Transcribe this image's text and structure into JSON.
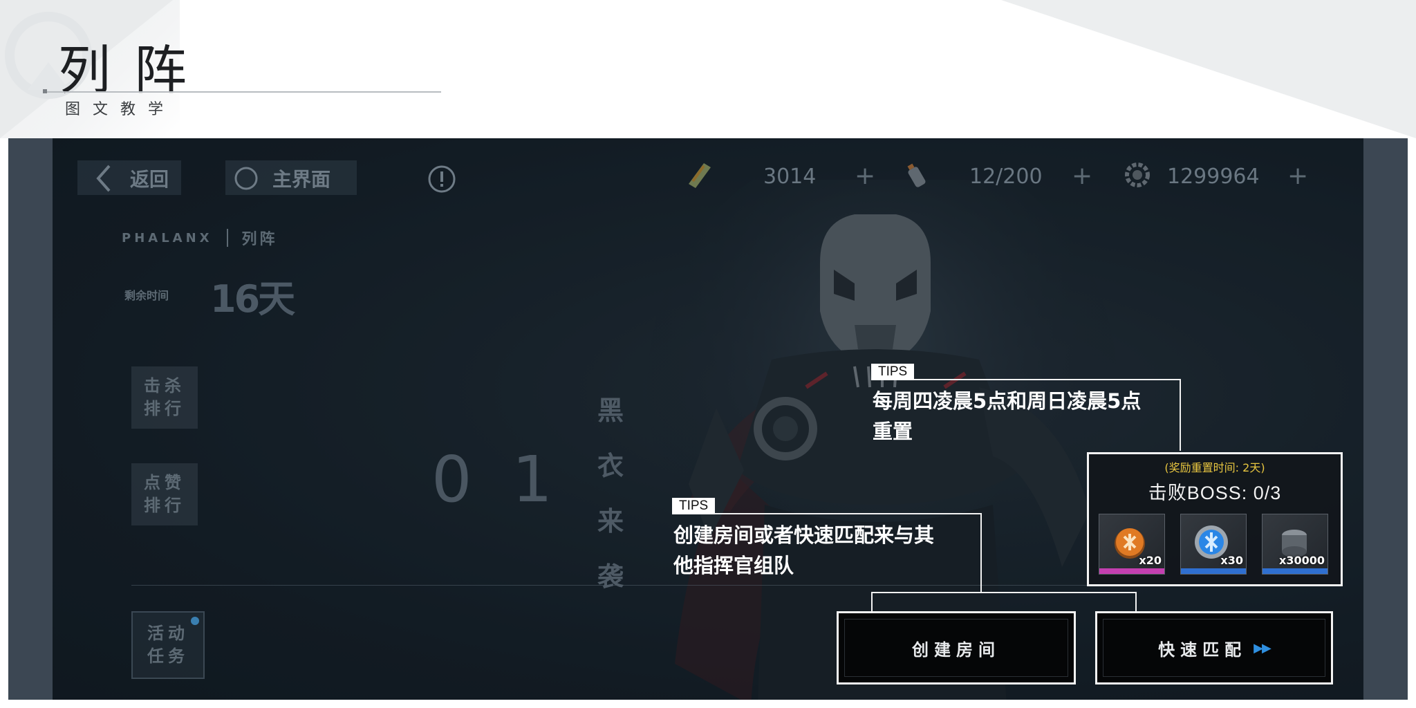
{
  "guide": {
    "title": "列阵",
    "subtitle": "图文教学"
  },
  "topbar": {
    "back_label": "返回",
    "home_label": "主界面",
    "resources": [
      {
        "icon": "ticket-icon",
        "value": "3014"
      },
      {
        "icon": "battery-icon",
        "value": "12/200"
      },
      {
        "icon": "gear-coin-icon",
        "value": "1299964"
      }
    ],
    "plus_glyph": "+"
  },
  "event": {
    "code": "PHALANX",
    "name": "列阵",
    "remain_label": "剩余时间",
    "remain_value": "16天"
  },
  "side_buttons": {
    "kill_rank": "击杀排行",
    "like_rank": "点赞排行",
    "activity_tasks": "活动任务"
  },
  "stage": {
    "number": "01",
    "name": "黑衣来袭"
  },
  "tips": [
    {
      "tag": "TIPS",
      "line1": "每周四凌晨5点和周日凌晨5点",
      "line2": "重置"
    },
    {
      "tag": "TIPS",
      "line1": "创建房间或者快速匹配来与其",
      "line2": "他指挥官组队"
    }
  ],
  "reward": {
    "reset_text": "(奖励重置时间: 2天)",
    "boss_text": "击败BOSS: 0/3",
    "items": [
      {
        "icon": "orange-chip-icon",
        "count": "x20",
        "accent": "#c43fb0"
      },
      {
        "icon": "blue-chip-icon",
        "count": "x30",
        "accent": "#2f6fd0"
      },
      {
        "icon": "canister-icon",
        "count": "x30000",
        "accent": "#2f6fd0"
      }
    ]
  },
  "actions": {
    "create_room": "创建房间",
    "quick_match": "快速匹配",
    "quick_match_arrow": "▶▶"
  },
  "colors": {
    "tips_accent": "#ffffff",
    "reward_reset": "#e8c640",
    "quick_match_arrow": "#2f8fe0"
  }
}
